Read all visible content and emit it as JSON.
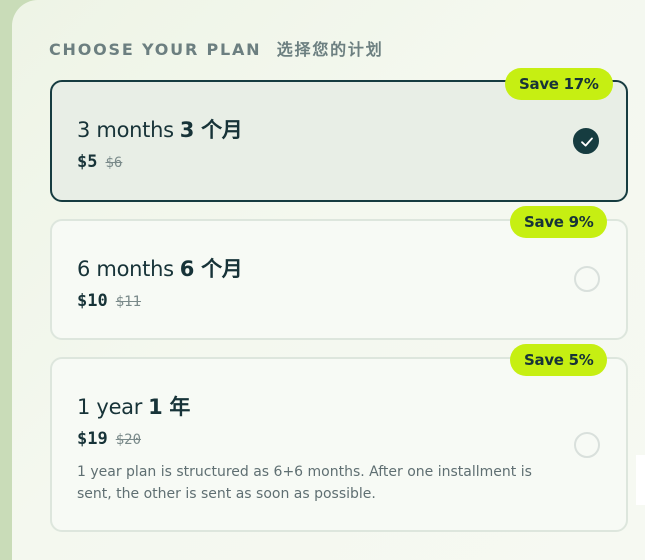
{
  "heading": {
    "en": "CHOOSE YOUR PLAN",
    "cn": "选择您的计划"
  },
  "plans": [
    {
      "title_en": "3 months",
      "title_cn": "3 个月",
      "price": "$5",
      "old_price": "$6",
      "badge": "Save 17%",
      "selected": true
    },
    {
      "title_en": "6 months",
      "title_cn": "6 个月",
      "price": "$10",
      "old_price": "$11",
      "badge": "Save 9%",
      "selected": false
    },
    {
      "title_en": "1 year",
      "title_cn": "1 年",
      "price": "$19",
      "old_price": "$20",
      "badge": "Save 5%",
      "selected": false,
      "note": "1 year plan is structured as 6+6 months. After one installment is sent, the other is sent as soon as possible."
    }
  ],
  "icons": {
    "check": "check-icon"
  },
  "colors": {
    "accent": "#c6ef12",
    "dark": "#163c40",
    "text": "#173338"
  }
}
